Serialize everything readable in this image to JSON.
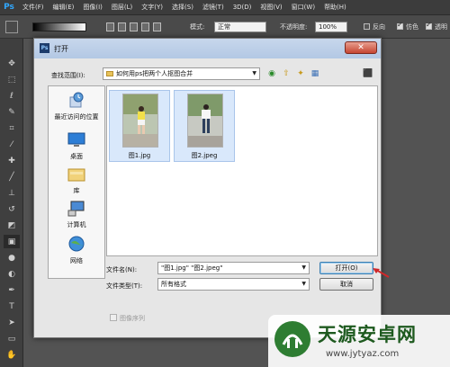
{
  "app": {
    "logo": "Ps"
  },
  "menu": [
    "文件(F)",
    "编辑(E)",
    "图像(I)",
    "图层(L)",
    "文字(Y)",
    "选择(S)",
    "滤镜(T)",
    "3D(D)",
    "视图(V)",
    "窗口(W)",
    "帮助(H)"
  ],
  "options": {
    "mode_label": "模式:",
    "mode_value": "正常",
    "opacity_label": "不透明度:",
    "opacity_value": "100%",
    "reverse_label": "反向",
    "dither_label": "仿色",
    "transparency_label": "透明",
    "reverse_checked": false,
    "dither_checked": true,
    "transparency_checked": true
  },
  "dialog": {
    "title": "打开",
    "title_icon": "Ps",
    "look_in_label": "查找范围(I):",
    "look_in_value": "如何用ps把两个人抠图合并",
    "places": [
      {
        "label": "最近访问的位置",
        "icon": "recent-places-icon"
      },
      {
        "label": "桌面",
        "icon": "desktop-icon"
      },
      {
        "label": "库",
        "icon": "library-icon"
      },
      {
        "label": "计算机",
        "icon": "computer-icon"
      },
      {
        "label": "网络",
        "icon": "network-icon"
      }
    ],
    "files": [
      {
        "name": "图1.jpg"
      },
      {
        "name": "图2.jpeg"
      }
    ],
    "filename_label": "文件名(N):",
    "filename_value": "\"图1.jpg\" \"图2.jpeg\"",
    "filetype_label": "文件类型(T):",
    "filetype_value": "所有格式",
    "open_button": "打开(O)",
    "cancel_button": "取消",
    "image_sequence_label": "图像序列"
  },
  "watermark": {
    "title": "天源安卓网",
    "url": "www.jytyaz.com"
  },
  "colors": {
    "ps_blue": "#31a8ff",
    "close_red": "#c64531",
    "arrow_red": "#d0282a",
    "watermark_green": "#2e7d32"
  }
}
